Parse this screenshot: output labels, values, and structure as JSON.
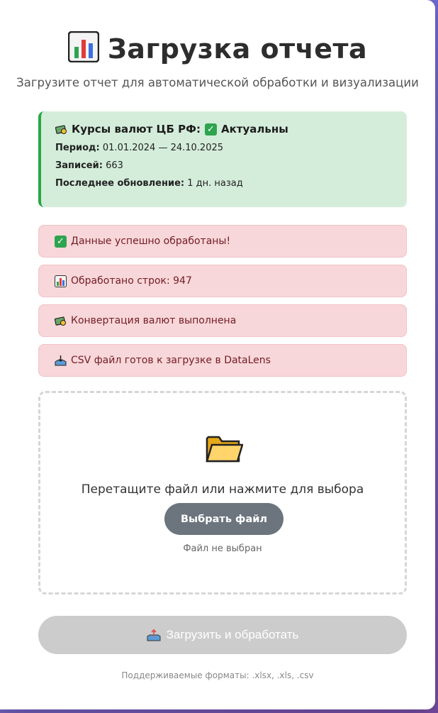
{
  "header": {
    "title": "Загрузка отчета",
    "subtitle": "Загрузите отчет для автоматической обработки и визуализации"
  },
  "rates": {
    "title": "Курсы валют ЦБ РФ:",
    "status": "Актуальны",
    "period_label": "Период:",
    "period_value": "01.01.2024 — 24.10.2025",
    "records_label": "Записей:",
    "records_value": "663",
    "updated_label": "Последнее обновление:",
    "updated_value": "1 дн. назад"
  },
  "messages": [
    {
      "text": "Данные успешно обработаны!",
      "icon": "check-icon"
    },
    {
      "text": "Обработано строк: 947",
      "icon": "chart-icon"
    },
    {
      "text": "Конвертация валют выполнена",
      "icon": "currency-icon"
    },
    {
      "text": "CSV файл готов к загрузке в DataLens",
      "icon": "inbox-tray-icon"
    }
  ],
  "dropzone": {
    "icon": "folder-icon",
    "text": "Перетащите файл или нажмите для выбора",
    "button": "Выбрать файл",
    "status": "Файл не выбран"
  },
  "upload": {
    "button": "Загрузить и обработать",
    "icon": "outbox-tray-icon"
  },
  "footer": {
    "formats": "Поддерживаемые форматы: .xlsx, .xls, .csv"
  },
  "colors": {
    "accent_green": "#28a745",
    "success_bg": "#d4edda",
    "message_bg": "#f8d7da",
    "message_text": "#721c24",
    "button_gray": "#6c757d",
    "disabled_button": "#cccccc"
  }
}
